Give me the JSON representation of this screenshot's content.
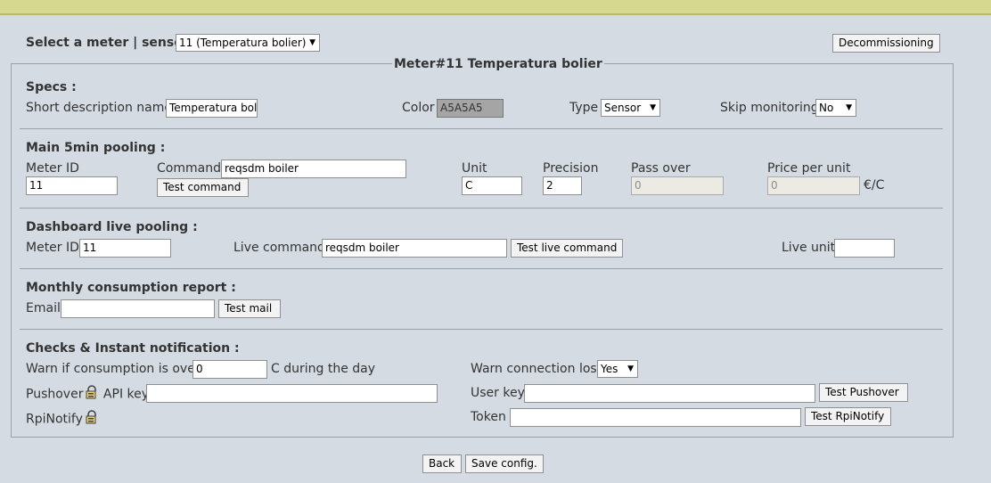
{
  "selector": {
    "label": "Select a meter | sensor :",
    "value": "11 (Temperatura bolier)"
  },
  "decommission_label": "Decommissioning",
  "legend": "Meter#11 Temperatura bolier",
  "specs": {
    "header": "Specs :",
    "short_desc_label": "Short description name",
    "short_desc_value": "Temperatura boli",
    "color_label": "Color",
    "color_value": "A5A5A5",
    "color_hex": "#a5a5a5",
    "type_label": "Type",
    "type_value": "Sensor",
    "skip_label": "Skip monitoring",
    "skip_value": "No"
  },
  "main": {
    "header": "Main 5min pooling :",
    "meter_id_label": "Meter ID",
    "meter_id_value": "11",
    "command_label": "Command",
    "command_value": "reqsdm boiler",
    "test_command": "Test command",
    "unit_label": "Unit",
    "unit_value": "C",
    "precision_label": "Precision",
    "precision_value": "2",
    "pass_over_label": "Pass over",
    "pass_over_value": "0",
    "price_label": "Price per unit",
    "price_value": "0",
    "price_unit": "€/C"
  },
  "live": {
    "header": "Dashboard live pooling :",
    "meter_id_label": "Meter ID",
    "meter_id_value": "11",
    "command_label": "Live command",
    "command_value": "reqsdm boiler",
    "test_label": "Test live command",
    "unit_label": "Live unit",
    "unit_value": ""
  },
  "monthly": {
    "header": "Monthly consumption report :",
    "email_label": "Email",
    "email_value": "",
    "test_mail": "Test mail"
  },
  "checks": {
    "header": "Checks & Instant notification :",
    "warn_label": "Warn if consumption is over",
    "warn_value": "0",
    "warn_suffix": "C during the day",
    "conn_label": "Warn connection lost",
    "conn_value": "Yes",
    "pushover_label": "Pushover",
    "api_key_label": "API key",
    "api_key_value": "",
    "user_key_label": "User key",
    "user_key_value": "",
    "test_pushover": "Test Pushover",
    "rpinotify_label": "RpiNotify",
    "token_label": "Token",
    "token_value": "",
    "test_rpinotify": "Test RpiNotify"
  },
  "footer": {
    "back": "Back",
    "save": "Save config."
  }
}
